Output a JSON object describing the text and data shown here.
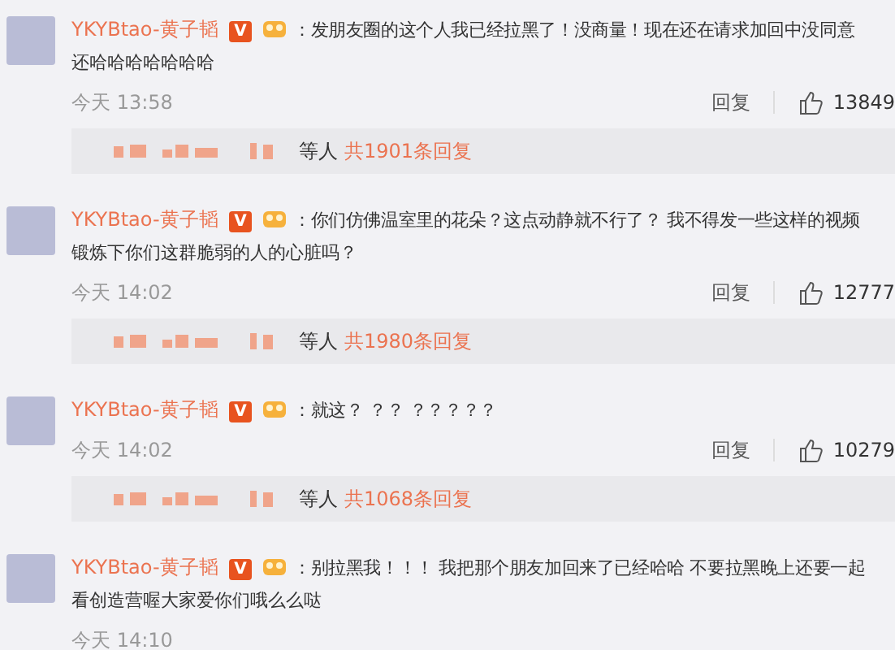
{
  "comments": [
    {
      "name": "YKYBtao-黄子韬",
      "badge": "V",
      "lines": [
        "：发朋友圈的这个人我已经拉黑了！没商量！现在还在请求加回中没同意",
        "还哈哈哈哈哈哈哈"
      ],
      "time": "今天 13:58",
      "reply_label": "回复",
      "likes": "13849",
      "replies": {
        "suffix": "等人",
        "total": "共1901条回复"
      }
    },
    {
      "name": "YKYBtao-黄子韬",
      "badge": "V",
      "lines": [
        "：你们仿佛温室里的花朵？这点动静就不行了？ 我不得发一些这样的视频",
        "锻炼下你们这群脆弱的人的心脏吗？"
      ],
      "time": "今天 14:02",
      "reply_label": "回复",
      "likes": "12777",
      "replies": {
        "suffix": "等人",
        "total": "共1980条回复"
      }
    },
    {
      "name": "YKYBtao-黄子韬",
      "badge": "V",
      "lines": [
        "：就这？ ？？ ？？？？？"
      ],
      "time": "今天 14:02",
      "reply_label": "回复",
      "likes": "10279",
      "replies": {
        "suffix": "等人",
        "total": "共1068条回复"
      }
    },
    {
      "name": "YKYBtao-黄子韬",
      "badge": "V",
      "lines": [
        "：别拉黑我！！！ 我把那个朋友加回来了已经哈哈 不要拉黑晚上还要一起",
        "看创造营喔大家爱你们哦么么哒"
      ],
      "time": "今天 14:10"
    }
  ]
}
